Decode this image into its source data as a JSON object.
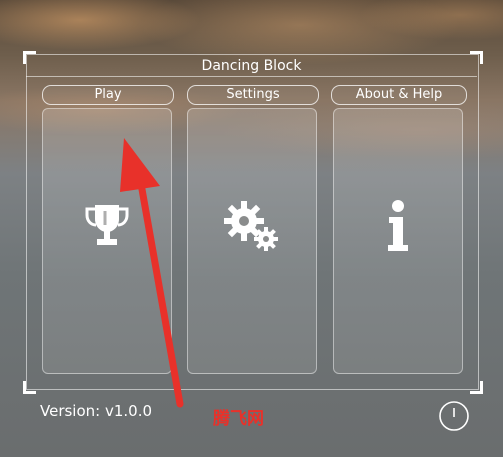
{
  "window": {
    "title": "Dancing Block"
  },
  "tabs": [
    {
      "label": "Play",
      "icon": "trophy-icon"
    },
    {
      "label": "Settings",
      "icon": "gears-icon"
    },
    {
      "label": "About & Help",
      "icon": "info-icon"
    }
  ],
  "footer": {
    "version": "Version: v1.0.0",
    "watermark": "腾飞网",
    "power_icon": "power-icon"
  },
  "colors": {
    "annotation_arrow": "#e8312a",
    "foreground": "#ffffff"
  }
}
